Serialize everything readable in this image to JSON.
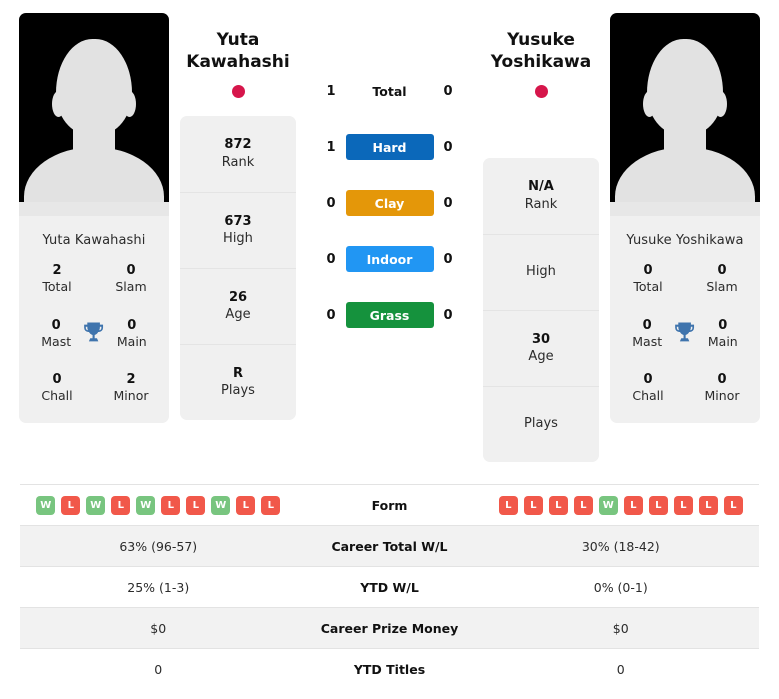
{
  "players": {
    "left": {
      "first_name": "Yuta",
      "last_name": "Kawahashi",
      "full_name": "Yuta Kawahashi",
      "flag_color": "#d6164b",
      "titles": {
        "total_value": "2",
        "total_label": "Total",
        "slam_value": "0",
        "slam_label": "Slam",
        "mast_value": "0",
        "mast_label": "Mast",
        "main_value": "0",
        "main_label": "Main",
        "chall_value": "0",
        "chall_label": "Chall",
        "minor_value": "2",
        "minor_label": "Minor",
        "trophy_icon": "trophy-icon"
      },
      "info": [
        {
          "value": "872",
          "label": "Rank"
        },
        {
          "value": "673",
          "label": "High"
        },
        {
          "value": "26",
          "label": "Age"
        },
        {
          "value": "R",
          "label": "Plays"
        }
      ],
      "surface_counts": {
        "total": "1",
        "hard": "1",
        "clay": "0",
        "indoor": "0",
        "grass": "0"
      },
      "form": [
        "W",
        "L",
        "W",
        "L",
        "W",
        "L",
        "L",
        "W",
        "L",
        "L"
      ],
      "career_total_wl": "63% (96-57)",
      "ytd_wl": "25% (1-3)",
      "career_prize_money": "$0",
      "ytd_titles": "0"
    },
    "right": {
      "first_name": "Yusuke",
      "last_name": "Yoshikawa",
      "full_name": "Yusuke Yoshikawa",
      "flag_color": "#d6164b",
      "titles": {
        "total_value": "0",
        "total_label": "Total",
        "slam_value": "0",
        "slam_label": "Slam",
        "mast_value": "0",
        "mast_label": "Mast",
        "main_value": "0",
        "main_label": "Main",
        "chall_value": "0",
        "chall_label": "Chall",
        "minor_value": "0",
        "minor_label": "Minor",
        "trophy_icon": "trophy-icon"
      },
      "info": [
        {
          "value": "N/A",
          "label": "Rank"
        },
        {
          "value": "",
          "label": "High"
        },
        {
          "value": "30",
          "label": "Age"
        },
        {
          "value": "",
          "label": "Plays"
        }
      ],
      "surface_counts": {
        "total": "0",
        "hard": "0",
        "clay": "0",
        "indoor": "0",
        "grass": "0"
      },
      "form": [
        "L",
        "L",
        "L",
        "L",
        "W",
        "L",
        "L",
        "L",
        "L",
        "L"
      ],
      "career_total_wl": "30% (18-42)",
      "ytd_wl": "0% (0-1)",
      "career_prize_money": "$0",
      "ytd_titles": "0"
    }
  },
  "surfaces": [
    {
      "key": "total",
      "label": "Total",
      "is_badge": false,
      "color": ""
    },
    {
      "key": "hard",
      "label": "Hard",
      "is_badge": true,
      "color": "#0b68ba"
    },
    {
      "key": "clay",
      "label": "Clay",
      "is_badge": true,
      "color": "#e49709"
    },
    {
      "key": "indoor",
      "label": "Indoor",
      "is_badge": true,
      "color": "#2196f3"
    },
    {
      "key": "grass",
      "label": "Grass",
      "is_badge": true,
      "color": "#15923d"
    }
  ],
  "stats_table": {
    "rows": [
      {
        "label": "Form",
        "type": "form"
      },
      {
        "label": "Career Total W/L",
        "type": "text",
        "key": "career_total_wl"
      },
      {
        "label": "YTD W/L",
        "type": "text",
        "key": "ytd_wl"
      },
      {
        "label": "Career Prize Money",
        "type": "text",
        "key": "career_prize_money"
      },
      {
        "label": "YTD Titles",
        "type": "text",
        "key": "ytd_titles"
      }
    ]
  },
  "colors": {
    "win_badge": "#78c57f",
    "loss_badge": "#f1584a",
    "trophy": "#3f74ad",
    "card_bg": "#f0f0f0",
    "row_shade": "#f2f2f2"
  }
}
